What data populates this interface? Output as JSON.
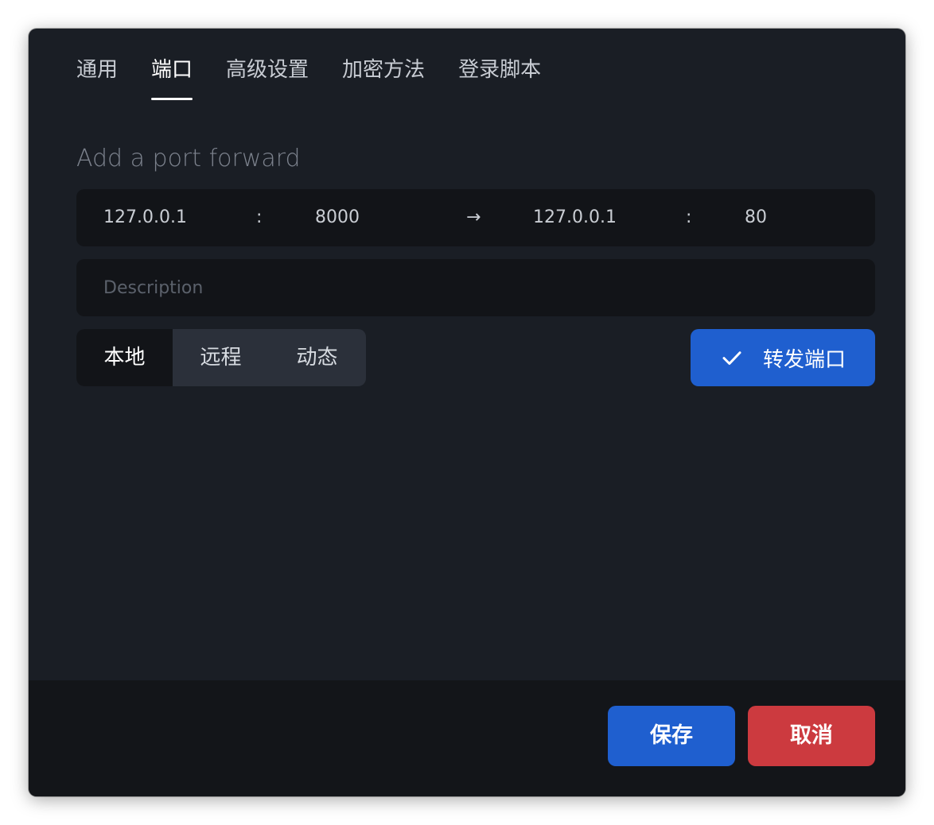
{
  "tabs": [
    {
      "label": "通用"
    },
    {
      "label": "端口",
      "active": true
    },
    {
      "label": "高级设置"
    },
    {
      "label": "加密方法"
    },
    {
      "label": "登录脚本"
    }
  ],
  "section_title": "Add a port forward",
  "forward": {
    "local_host": "127.0.0.1",
    "sep1": ":",
    "local_port": "8000",
    "arrow": "→",
    "remote_host": "127.0.0.1",
    "sep2": ":",
    "remote_port": "80"
  },
  "description": {
    "value": "",
    "placeholder": "Description"
  },
  "modes": [
    {
      "label": "本地",
      "selected": true
    },
    {
      "label": "远程"
    },
    {
      "label": "动态"
    }
  ],
  "forward_button": {
    "label": "转发端口",
    "icon": "check-icon"
  },
  "footer": {
    "save_label": "保存",
    "cancel_label": "取消"
  },
  "colors": {
    "dialog_bg": "#1a1e25",
    "field_bg": "#121418",
    "accent_blue": "#1f5fcf",
    "danger_red": "#cc3a3f"
  }
}
